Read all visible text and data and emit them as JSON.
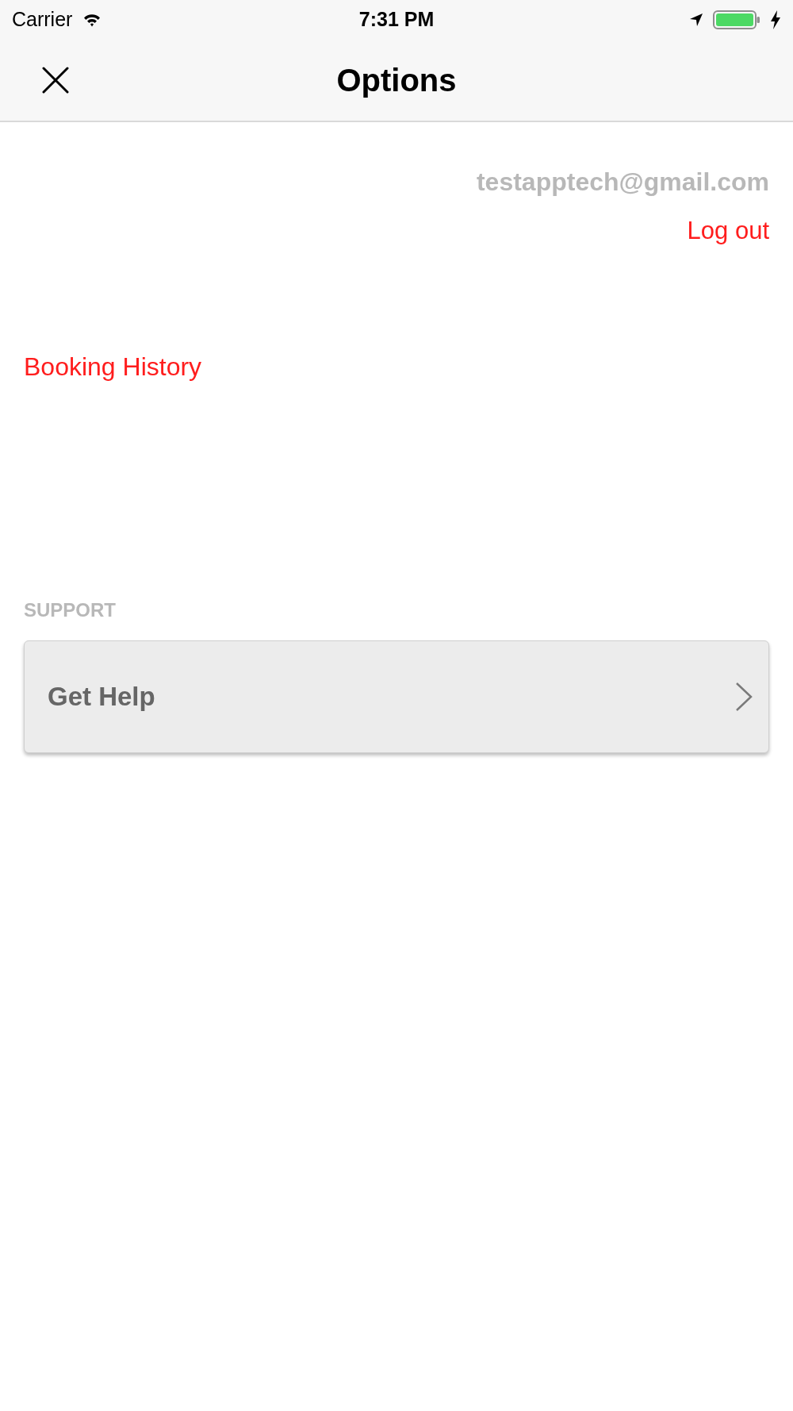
{
  "status_bar": {
    "carrier": "Carrier",
    "time": "7:31 PM"
  },
  "nav_bar": {
    "title": "Options"
  },
  "account": {
    "email": "testapptech@gmail.com",
    "logout_label": "Log out"
  },
  "links": [
    {
      "label": "Booking History"
    }
  ],
  "sections": [
    {
      "header": "SUPPORT",
      "items": [
        {
          "label": "Get Help"
        }
      ]
    }
  ]
}
